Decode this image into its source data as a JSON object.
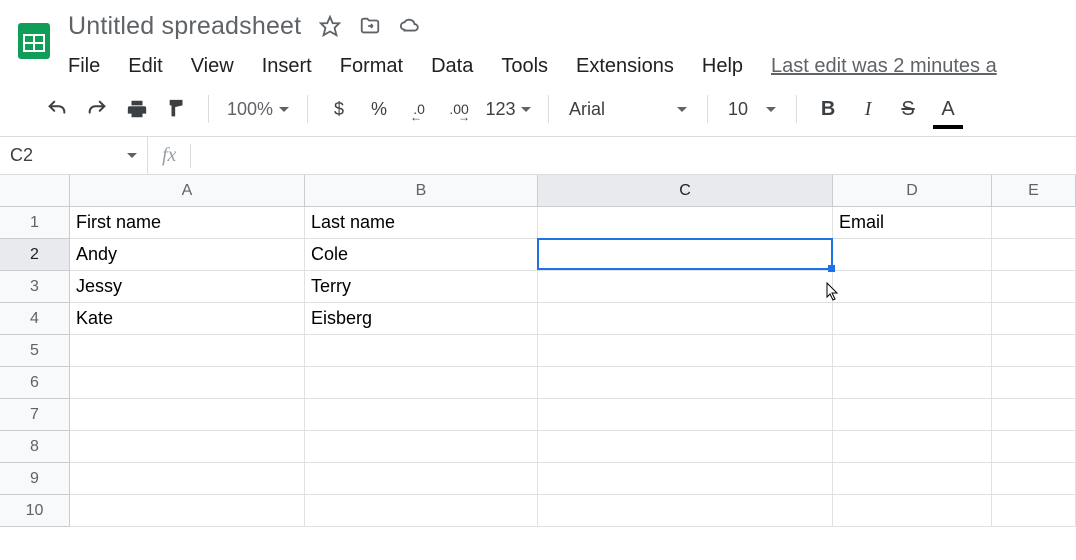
{
  "doc": {
    "title": "Untitled spreadsheet"
  },
  "menu": {
    "file": "File",
    "edit": "Edit",
    "view": "View",
    "insert": "Insert",
    "format": "Format",
    "data": "Data",
    "tools": "Tools",
    "extensions": "Extensions",
    "help": "Help",
    "last_edit": "Last edit was 2 minutes a"
  },
  "toolbar": {
    "zoom": "100%",
    "currency": "$",
    "percent": "%",
    "dec_dec": ".0",
    "inc_dec": ".00",
    "numfmt": "123",
    "font": "Arial",
    "fontsize": "10",
    "bold": "B",
    "italic": "I",
    "strike": "S",
    "textcolor": "A"
  },
  "namebox": {
    "ref": "C2",
    "fx": "fx",
    "formula": ""
  },
  "columns": [
    "A",
    "B",
    "C",
    "D",
    "E"
  ],
  "rows": [
    "1",
    "2",
    "3",
    "4",
    "5",
    "6",
    "7",
    "8",
    "9",
    "10"
  ],
  "active": {
    "col": "C",
    "row": "2"
  },
  "cells": {
    "r1": {
      "A": "First name",
      "B": "Last name",
      "C": "",
      "D": "Email",
      "E": ""
    },
    "r2": {
      "A": "Andy",
      "B": "Cole",
      "C": "",
      "D": "",
      "E": ""
    },
    "r3": {
      "A": "Jessy",
      "B": "Terry",
      "C": "",
      "D": "",
      "E": ""
    },
    "r4": {
      "A": "Kate",
      "B": "Eisberg",
      "C": "",
      "D": "",
      "E": ""
    }
  }
}
